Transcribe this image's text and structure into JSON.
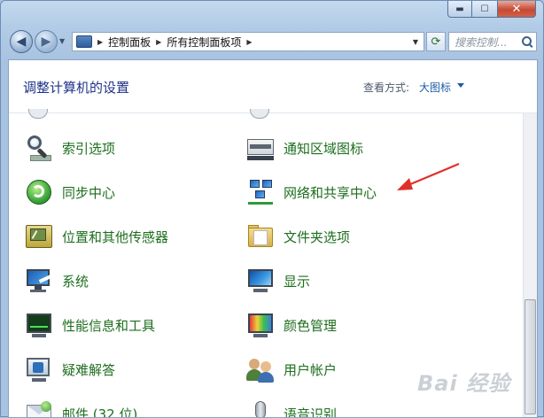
{
  "window": {
    "caption_min": "▬",
    "caption_max": "☐",
    "caption_close": "✕"
  },
  "nav": {
    "back_icon": "◀",
    "forward_icon": "▶",
    "dropdown_icon": "▼",
    "refresh_icon": "⟳"
  },
  "address": {
    "crumbs": [
      "控制面板",
      "所有控制面板项"
    ],
    "separator": "▶",
    "drop": "▼"
  },
  "search": {
    "placeholder": "搜索控制..."
  },
  "header": {
    "title": "调整计算机的设置",
    "view_by_label": "查看方式:",
    "view_by_value": "大图标"
  },
  "items_left": [
    {
      "label": "索引选项"
    },
    {
      "label": "同步中心"
    },
    {
      "label": "位置和其他传感器"
    },
    {
      "label": "系统"
    },
    {
      "label": "性能信息和工具"
    },
    {
      "label": "疑难解答"
    },
    {
      "label": "邮件 (32 位)"
    }
  ],
  "items_right": [
    {
      "label": "通知区域图标"
    },
    {
      "label": "网络和共享中心"
    },
    {
      "label": "文件夹选项"
    },
    {
      "label": "显示"
    },
    {
      "label": "颜色管理"
    },
    {
      "label": "用户帐户"
    },
    {
      "label": "语音识别"
    }
  ],
  "annotation_color": "#e0302a",
  "watermark": "Bai 经验"
}
